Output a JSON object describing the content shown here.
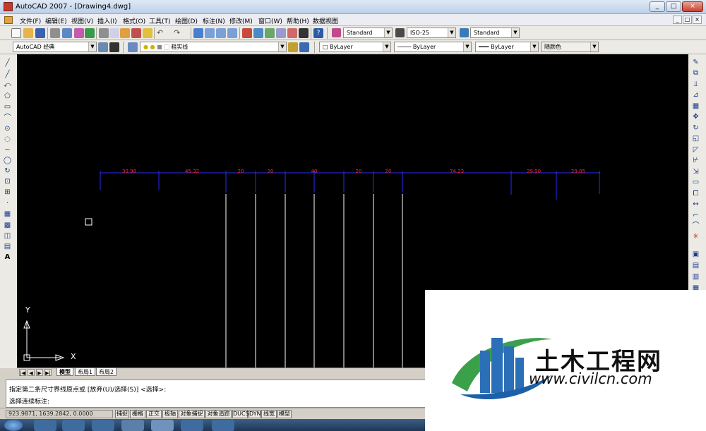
{
  "window": {
    "title": "AutoCAD 2007 - [Drawing4.dwg]",
    "minimize": "_",
    "maximize": "□",
    "close": "×"
  },
  "menu": {
    "items": [
      "文件(F)",
      "编辑(E)",
      "视图(V)",
      "插入(I)",
      "格式(O)",
      "工具(T)",
      "绘图(D)",
      "标注(N)",
      "修改(M)",
      "窗口(W)",
      "帮助(H)",
      "数据视图"
    ]
  },
  "toolbar1": {
    "text_style": "Standard",
    "dim_style": "ISO-25",
    "table_style": "Standard"
  },
  "toolbar2": {
    "workspace": "AutoCAD 经典",
    "layer": "粗实线",
    "color": "ByLayer",
    "linetype": "ByLayer",
    "lineweight": "ByLayer",
    "plotstyle": "随颜色"
  },
  "left_tools": [
    "╱",
    "╱",
    "⤺",
    "⬠",
    "▭",
    "⌒",
    "⊙",
    "◌",
    "∼",
    "◯",
    "↻",
    "⊡",
    "⊞",
    "·",
    "▦",
    "▩",
    "◫",
    "▤",
    "A"
  ],
  "right_tools": [
    "✎",
    "⧉",
    "⫫",
    "⊿",
    "▦",
    "✥",
    "↻",
    "◱",
    "◸",
    "⊬",
    "⇲",
    "▭",
    "⧠",
    "↔",
    "⌐",
    "⌒",
    "✳",
    "▣",
    "▤",
    "▥",
    "▦"
  ],
  "colors": {
    "canvas": "#000000",
    "dimension_line": "#2a2aff",
    "dimension_text": "#ff2a2a",
    "drawing_line": "#ffffff"
  },
  "dimensions": {
    "labels": [
      "30.98",
      "45.32",
      "20",
      "20",
      "40",
      "20",
      "20",
      "74.23",
      "29.90",
      "29.05"
    ]
  },
  "axis": {
    "y": "Y",
    "x": "X"
  },
  "tabs": {
    "nav": [
      "|◀",
      "◀",
      "▶",
      "▶|"
    ],
    "items": [
      "模型",
      "布局1",
      "布局2"
    ]
  },
  "command": {
    "line1": "指定第二条尺寸界线原点或 [放弃(U)/选择(S)] <选择>:",
    "line2": "选择连续标注:"
  },
  "status": {
    "coords": "923.9871,  1639.2842, 0.0000",
    "buttons": [
      "捕捉",
      "栅格",
      "正交",
      "极轴",
      "对象捕捉",
      "对象追踪",
      "DUCS",
      "DYN",
      "线宽",
      "模型"
    ]
  },
  "watermark": {
    "brand": "土木工程网",
    "url": "www.civilcn.com"
  }
}
